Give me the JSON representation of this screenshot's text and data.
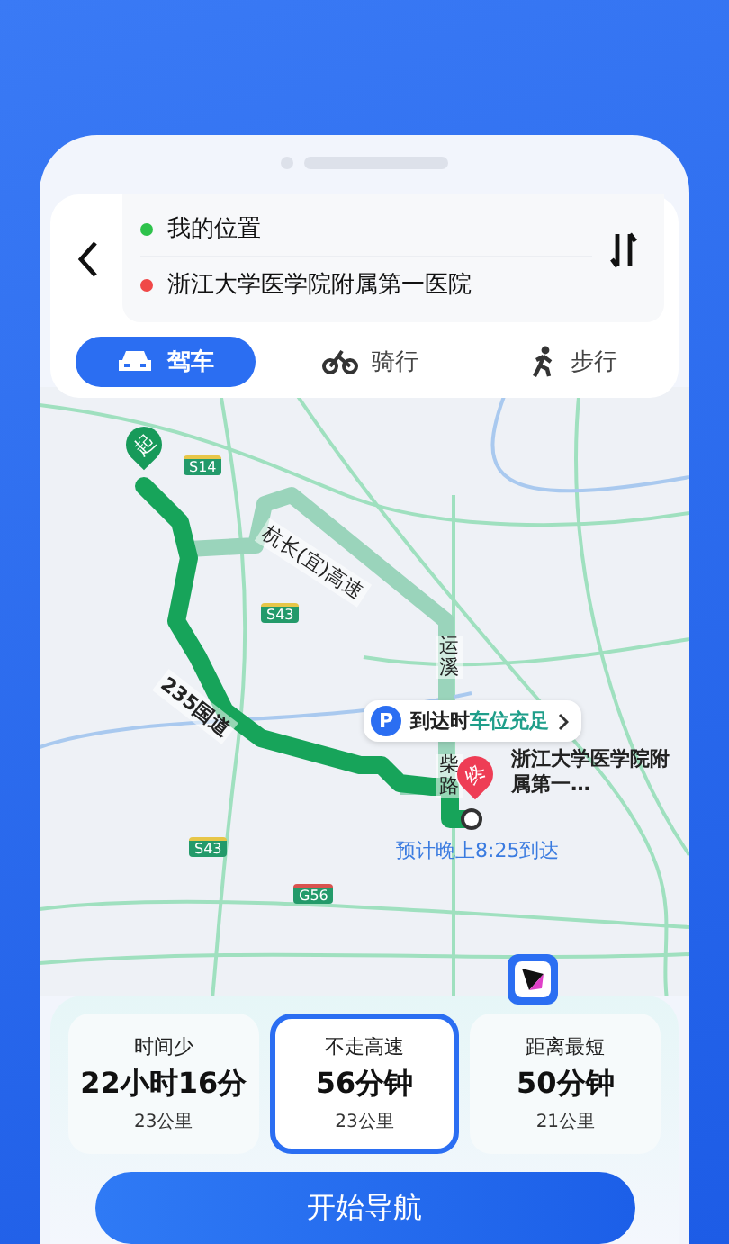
{
  "route_header": {
    "origin": "我的位置",
    "destination": "浙江大学医学院附属第一医院"
  },
  "modes": [
    {
      "kind": "car",
      "label": "驾车",
      "selected": true
    },
    {
      "kind": "bike",
      "label": "骑行",
      "selected": false
    },
    {
      "kind": "walk",
      "label": "步行",
      "selected": false
    }
  ],
  "map": {
    "start_marker": "起",
    "end_marker": "终",
    "destination_label": "浙江大学医学院附属第一…",
    "eta": "预计晚上8:25到达",
    "parking": {
      "prefix": "到达时",
      "status": "车位充足",
      "icon": "P"
    },
    "road_names": [
      {
        "text": "杭长(宜)高速",
        "kind": "diag"
      },
      {
        "text": "235国道",
        "kind": "route"
      },
      {
        "text": "运溪",
        "kind": "vertical"
      },
      {
        "text": "柴路",
        "kind": "vertical2"
      }
    ],
    "shields": [
      {
        "text": "S14",
        "kind": "s14"
      },
      {
        "text": "S43",
        "kind": "s43a"
      },
      {
        "text": "S43",
        "kind": "s43b"
      },
      {
        "text": "G56",
        "kind": "g56"
      }
    ]
  },
  "route_options": [
    {
      "label": "时间少",
      "duration": "22小时16分",
      "distance": "23公里",
      "selected": false
    },
    {
      "label": "不走高速",
      "duration": "56分钟",
      "distance": "23公里",
      "selected": true
    },
    {
      "label": "距离最短",
      "duration": "50分钟",
      "distance": "21公里",
      "selected": false
    }
  ],
  "start_button": "开始导航"
}
